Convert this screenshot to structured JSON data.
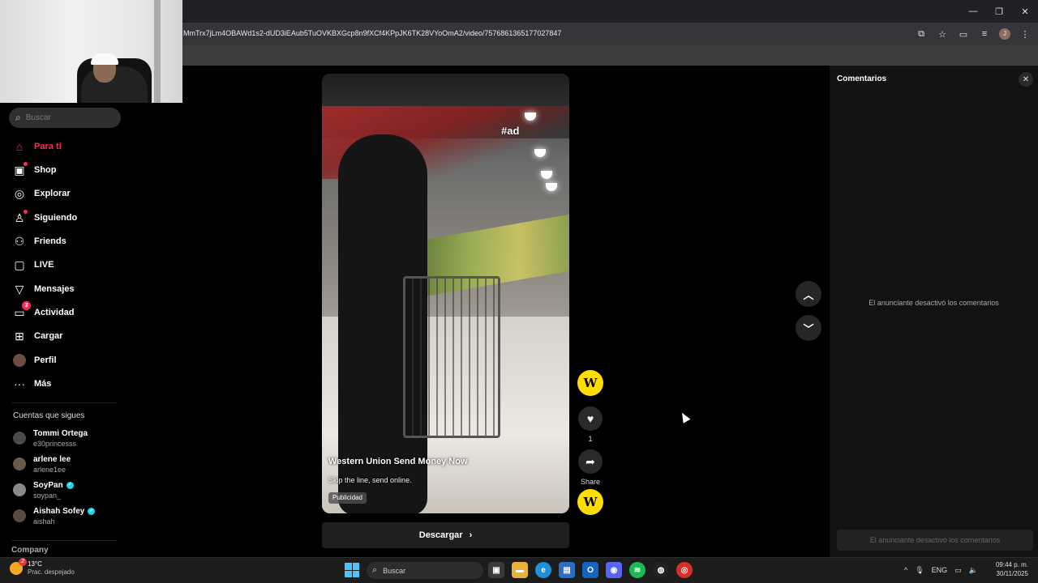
{
  "browser": {
    "url": "MmTrx7jLm4OBAWd1s2-dUD3iEAub5TuOVKBXGcp8n9fXCf4KPpJK6TK28VYoOmA2/video/7576861365177027847",
    "window_controls": [
      "—",
      "❐",
      "✕"
    ],
    "profile_initial": "J"
  },
  "sidebar": {
    "search_placeholder": "Buscar",
    "nav": [
      {
        "label": "Para ti",
        "icon": "home-icon",
        "active": true
      },
      {
        "label": "Shop",
        "icon": "shop-icon",
        "dot": true
      },
      {
        "label": "Explorar",
        "icon": "compass-icon"
      },
      {
        "label": "Siguiendo",
        "icon": "following-icon",
        "dot": true
      },
      {
        "label": "Friends",
        "icon": "friends-icon"
      },
      {
        "label": "LIVE",
        "icon": "live-icon"
      },
      {
        "label": "Mensajes",
        "icon": "message-icon"
      },
      {
        "label": "Actividad",
        "icon": "activity-icon",
        "badge": "3"
      },
      {
        "label": "Cargar",
        "icon": "upload-icon"
      },
      {
        "label": "Perfil",
        "icon": "profile-avatar"
      },
      {
        "label": "Más",
        "icon": "more-icon"
      }
    ],
    "following_title": "Cuentas que sigues",
    "following": [
      {
        "name": "Tommi Ortega",
        "handle": "e30princesss",
        "verified": false
      },
      {
        "name": "arlene lee",
        "handle": "arlene1ee",
        "verified": false
      },
      {
        "name": "SoyPan",
        "handle": "soypan_",
        "verified": true
      },
      {
        "name": "Aishah Sofey",
        "handle": "aishah",
        "verified": true
      }
    ],
    "company": "Company"
  },
  "video": {
    "overlay_tag": "#ad",
    "title": "Western Union Send Money Now",
    "subtitle": "Skip the line, send online.",
    "badge": "Publicidad",
    "download_label": "Descargar"
  },
  "actions": {
    "logo_letter": "W",
    "like_count": "1",
    "share_label": "Share"
  },
  "comments": {
    "title": "Comentarios",
    "disabled_message": "El anunciante desactivó los comentarios",
    "input_placeholder": "El anunciante desactivó los comentarios"
  },
  "taskbar": {
    "weather_badge": "2",
    "temperature": "13°C",
    "condition": "Prac. despejado",
    "search_label": "Buscar",
    "language": "ENG",
    "time": "09:44 p. m.",
    "date": "30/11/2025"
  },
  "colors": {
    "accent": "#fe2c55",
    "western_union_yellow": "#ffdd00",
    "verified": "#20d5ec"
  }
}
